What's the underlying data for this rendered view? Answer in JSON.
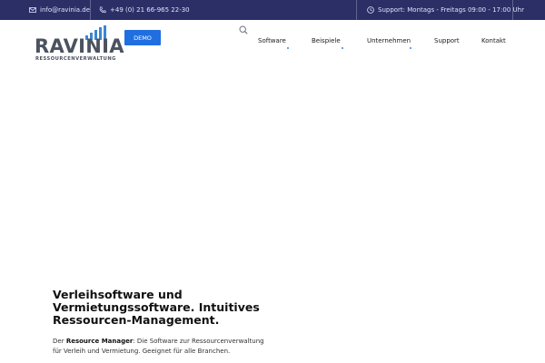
{
  "topbar": {
    "email": "info@ravinia.de",
    "phone": "+49 (0) 21 66-965 22-30",
    "hours": "Support: Montags - Freitags 09:00 - 17:00 Uhr"
  },
  "logo": {
    "word": "RAVINIA",
    "sub": "RESSOURCENVERWALTUNG"
  },
  "demo_label": "DEMO",
  "nav": {
    "items": [
      {
        "label": "Software"
      },
      {
        "label": "Beispiele"
      },
      {
        "label": "Unternehmen"
      },
      {
        "label": "Support"
      },
      {
        "label": "Kontakt"
      }
    ]
  },
  "hero": {
    "title": "Verleihsoftware und Vermietungssoftware. Intuitives Ressourcen-Management.",
    "text_prefix": "Der ",
    "text_bold": "Resource Manager",
    "text_rest": ": Die Software zur Ressourcenverwaltung für Verleih und Vermietung. Geeignet für alle Branchen."
  },
  "colors": {
    "topbar": "#2b2f66",
    "accent": "#1f6fe0",
    "logo_text": "#4b5260"
  }
}
